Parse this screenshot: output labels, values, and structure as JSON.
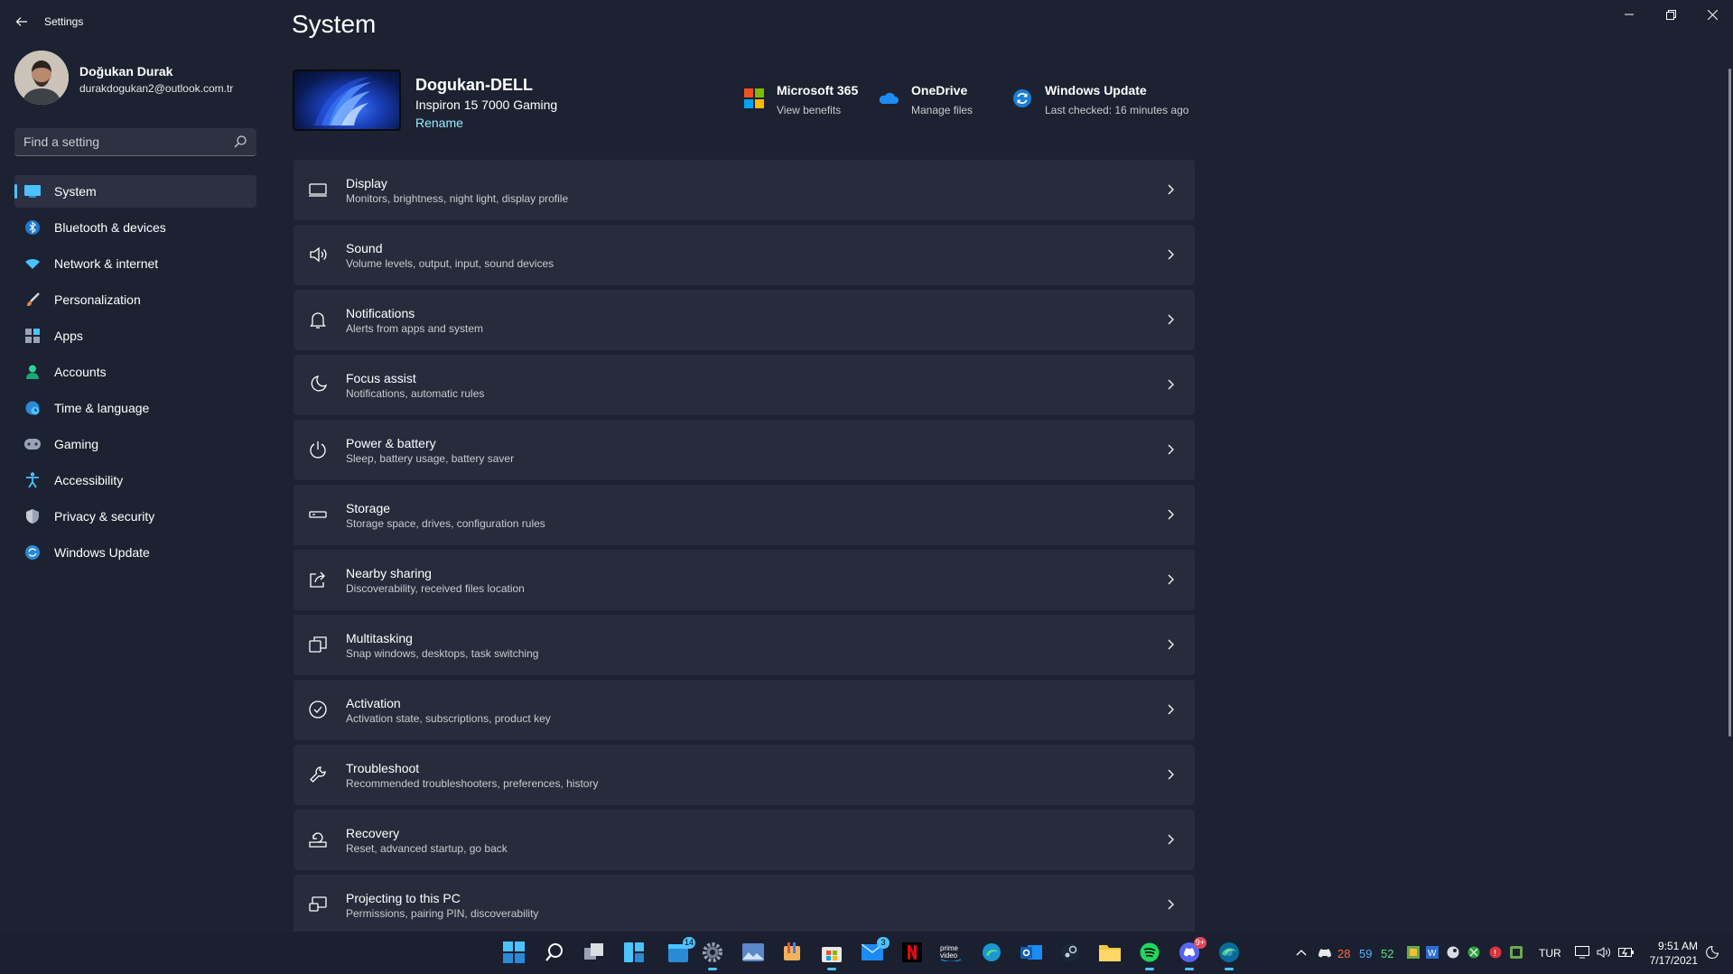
{
  "window": {
    "app_title": "Settings"
  },
  "profile": {
    "name": "Doğukan Durak",
    "email": "durakdogukan2@outlook.com.tr"
  },
  "search": {
    "placeholder": "Find a setting"
  },
  "sidebar": {
    "items": [
      {
        "label": "System",
        "icon": "system-icon",
        "active": true
      },
      {
        "label": "Bluetooth & devices",
        "icon": "bluetooth-icon"
      },
      {
        "label": "Network & internet",
        "icon": "wifi-icon"
      },
      {
        "label": "Personalization",
        "icon": "brush-icon"
      },
      {
        "label": "Apps",
        "icon": "apps-icon"
      },
      {
        "label": "Accounts",
        "icon": "person-icon"
      },
      {
        "label": "Time & language",
        "icon": "globe-clock-icon"
      },
      {
        "label": "Gaming",
        "icon": "gamepad-icon"
      },
      {
        "label": "Accessibility",
        "icon": "accessibility-icon"
      },
      {
        "label": "Privacy & security",
        "icon": "shield-icon"
      },
      {
        "label": "Windows Update",
        "icon": "update-icon"
      }
    ]
  },
  "main": {
    "title": "System",
    "device": {
      "name": "Dogukan-DELL",
      "model": "Inspiron 15 7000 Gaming",
      "rename_label": "Rename"
    },
    "quick_links": [
      {
        "title": "Microsoft 365",
        "subtitle": "View benefits",
        "icon": "microsoft-logo-icon"
      },
      {
        "title": "OneDrive",
        "subtitle": "Manage files",
        "icon": "onedrive-cloud-icon"
      },
      {
        "title": "Windows Update",
        "subtitle": "Last checked: 16 minutes ago",
        "icon": "sync-icon"
      }
    ],
    "cards": [
      {
        "title": "Display",
        "subtitle": "Monitors, brightness, night light, display profile",
        "icon": "display-icon"
      },
      {
        "title": "Sound",
        "subtitle": "Volume levels, output, input, sound devices",
        "icon": "speaker-icon"
      },
      {
        "title": "Notifications",
        "subtitle": "Alerts from apps and system",
        "icon": "bell-icon"
      },
      {
        "title": "Focus assist",
        "subtitle": "Notifications, automatic rules",
        "icon": "moon-icon"
      },
      {
        "title": "Power & battery",
        "subtitle": "Sleep, battery usage, battery saver",
        "icon": "power-icon"
      },
      {
        "title": "Storage",
        "subtitle": "Storage space, drives, configuration rules",
        "icon": "drive-icon"
      },
      {
        "title": "Nearby sharing",
        "subtitle": "Discoverability, received files location",
        "icon": "share-icon"
      },
      {
        "title": "Multitasking",
        "subtitle": "Snap windows, desktops, task switching",
        "icon": "multitask-icon"
      },
      {
        "title": "Activation",
        "subtitle": "Activation state, subscriptions, product key",
        "icon": "check-circle-icon"
      },
      {
        "title": "Troubleshoot",
        "subtitle": "Recommended troubleshooters, preferences, history",
        "icon": "wrench-icon"
      },
      {
        "title": "Recovery",
        "subtitle": "Reset, advanced startup, go back",
        "icon": "recovery-icon"
      },
      {
        "title": "Projecting to this PC",
        "subtitle": "Permissions, pairing PIN, discoverability",
        "icon": "projector-icon"
      }
    ]
  },
  "taskbar": {
    "badges": {
      "widgets": "14",
      "mail": "3",
      "discord": "9+"
    },
    "tray": {
      "temp1": "28",
      "temp2": "59",
      "temp3": "52",
      "language": "TUR"
    },
    "clock": {
      "time": "9:51 AM",
      "date": "7/17/2021"
    }
  },
  "colors": {
    "background": "#1c2231",
    "card": "#262c3c",
    "accent": "#4cc2ff",
    "link": "#99ebff"
  }
}
